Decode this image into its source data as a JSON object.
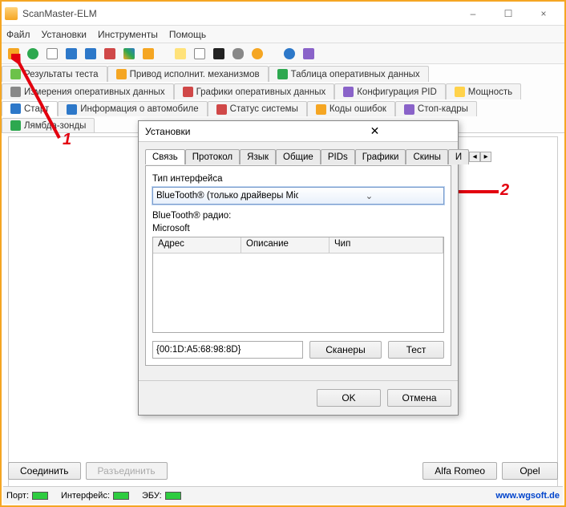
{
  "window": {
    "title": "ScanMaster-ELM",
    "minimize": "–",
    "maximize": "☐",
    "close": "×"
  },
  "menu": [
    "Файл",
    "Установки",
    "Инструменты",
    "Помощь"
  ],
  "subtabs": {
    "row1": [
      {
        "icon": "#6cc24a",
        "label": "Результаты теста"
      },
      {
        "icon": "#f5a623",
        "label": "Привод исполнит. механизмов"
      },
      {
        "icon": "#2da84f",
        "label": "Таблица оперативных данных"
      }
    ],
    "row2": [
      {
        "icon": "#888",
        "label": "Измерения оперативных данных"
      },
      {
        "icon": "#d04848",
        "label": "Графики оперативных данных"
      },
      {
        "icon": "#8a63c9",
        "label": "Конфигурация PID"
      },
      {
        "icon": "#ffd24a",
        "label": "Мощность"
      }
    ],
    "row3": [
      {
        "icon": "#2d78c9",
        "label": "Старт",
        "active": true
      },
      {
        "icon": "#2d78c9",
        "label": "Информация о автомобиле"
      },
      {
        "icon": "#d04848",
        "label": "Статус системы"
      },
      {
        "icon": "#f5a623",
        "label": "Коды ошибок"
      },
      {
        "icon": "#8a63c9",
        "label": "Стоп-кадры"
      },
      {
        "icon": "#2da84f",
        "label": "Лямбда-зонды"
      }
    ]
  },
  "bottom": {
    "connect": "Соединить",
    "disconnect": "Разъединить",
    "brand1": "Alfa Romeo",
    "brand2": "Opel"
  },
  "status": {
    "port": "Порт:",
    "iface": "Интерфейс:",
    "ecu": "ЭБУ:",
    "url": "www.wgsoft.de"
  },
  "annotations": {
    "label1": "1",
    "label2": "2"
  },
  "dialog": {
    "title": "Установки",
    "tabs": [
      "Связь",
      "Протокол",
      "Язык",
      "Общие",
      "PIDs",
      "Графики",
      "Скины",
      "И"
    ],
    "active_tab": 0,
    "iface_label": "Тип интерфейса",
    "iface_value": "BlueTooth® (только драйверы Microsoft, BlueSoleil, Toshiba, WidComm",
    "radio_label": "BlueTooth® радио:",
    "radio_value": "Microsoft",
    "grid_cols": [
      "Адрес",
      "Описание",
      "Чип"
    ],
    "address_value": "{00:1D:A5:68:98:8D}",
    "btn_scanners": "Сканеры",
    "btn_test": "Тест",
    "btn_ok": "OK",
    "btn_cancel": "Отмена"
  }
}
